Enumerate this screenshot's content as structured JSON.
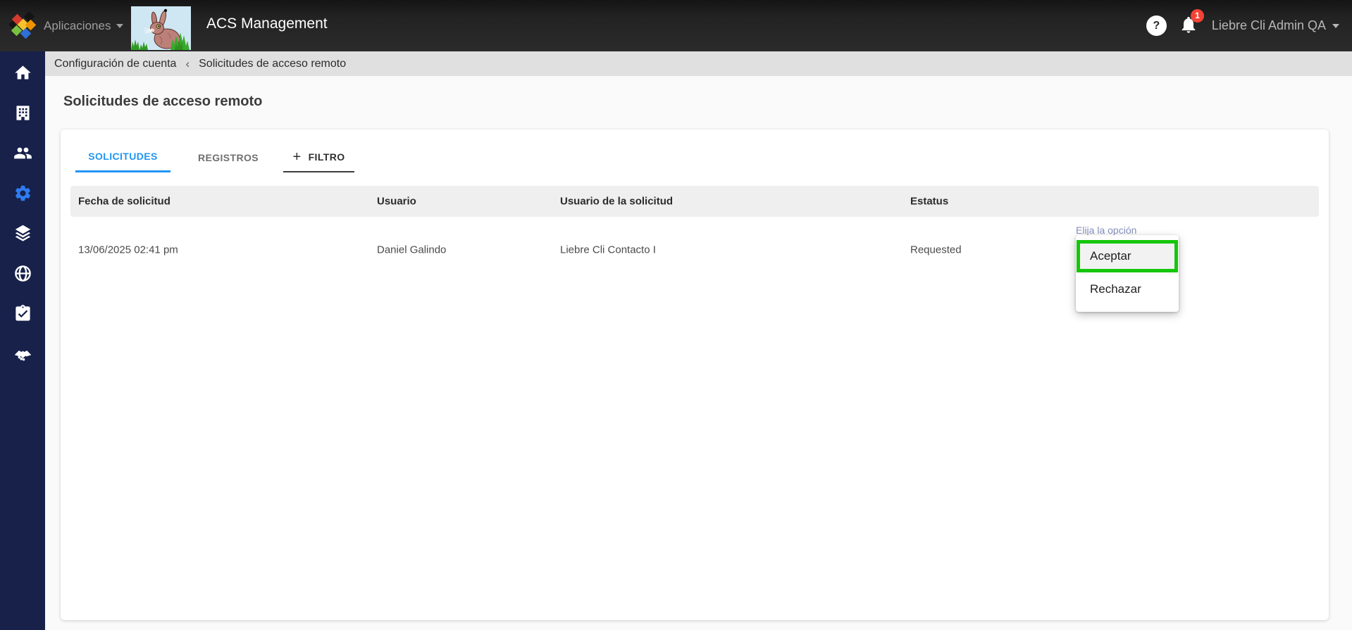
{
  "colors": {
    "tab_accent": "#2196f3",
    "sidebar_active_icon": "#2f7cf0",
    "highlight_green": "#16c60c",
    "badge_red": "#f44336"
  },
  "header": {
    "apps_menu": "Aplicaciones",
    "title": "ACS Management",
    "help": "?",
    "notification_badge": "1",
    "user_menu": "Liebre Cli Admin QA"
  },
  "sidebar": {
    "items": [
      {
        "icon": "home-icon"
      },
      {
        "icon": "building-icon"
      },
      {
        "icon": "people-icon"
      },
      {
        "icon": "settings-icon",
        "active": true
      },
      {
        "icon": "layers-icon"
      },
      {
        "icon": "globe-icon"
      },
      {
        "icon": "clipboard-check-icon"
      },
      {
        "icon": "handshake-icon"
      }
    ]
  },
  "breadcrumb": {
    "parent": "Configuración de cuenta",
    "separator": "‹",
    "current": "Solicitudes de acceso remoto"
  },
  "page": {
    "title": "Solicitudes de acceso remoto"
  },
  "tabs": {
    "solicitudes": "SOLICITUDES",
    "registros": "REGISTROS",
    "filtro": "FILTRO",
    "filtro_icon": "+"
  },
  "table": {
    "columns": [
      "Fecha de solicitud",
      "Usuario",
      "Usuario de la solicitud",
      "Estatus"
    ],
    "rows": [
      {
        "fecha": "13/06/2025 02:41 pm",
        "usuario": "Daniel Galindo",
        "usuario_solicitud": "Liebre Cli Contacto I",
        "estatus": "Requested",
        "accion_placeholder": "Elija la opción"
      }
    ]
  },
  "action_menu": {
    "options": [
      {
        "label": "Aceptar",
        "highlighted": true
      },
      {
        "label": "Rechazar",
        "highlighted": false
      }
    ]
  }
}
